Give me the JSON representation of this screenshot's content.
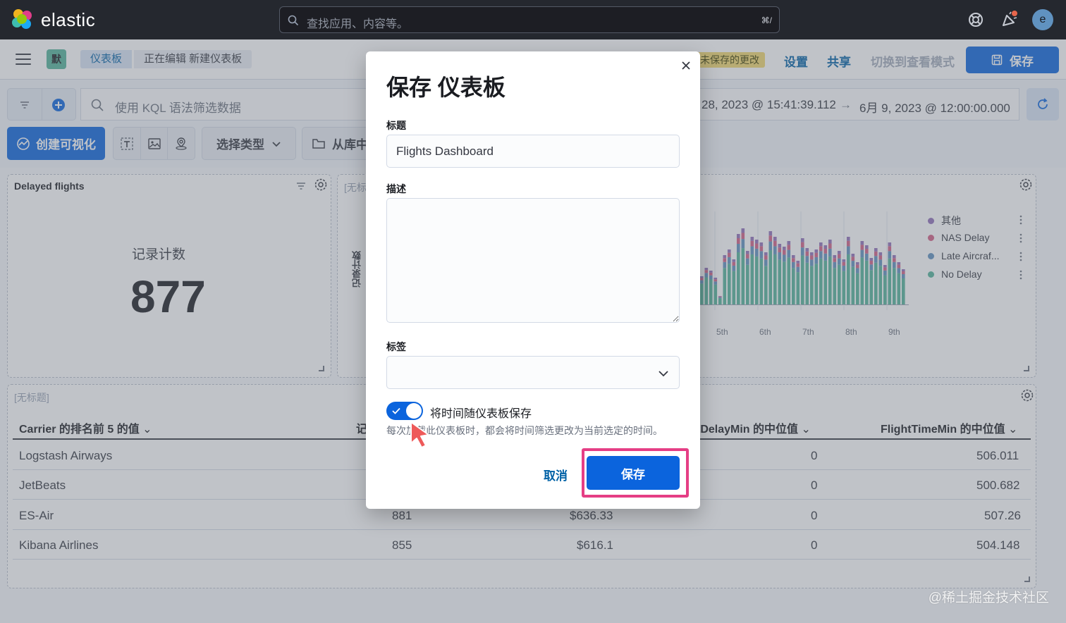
{
  "header": {
    "logo_text": "elastic",
    "search_placeholder": "查找应用、内容等。",
    "search_shortcut": "⌘/",
    "avatar_initial": "e"
  },
  "nav": {
    "space_badge": "默",
    "breadcrumbs": [
      "仪表板",
      "正在编辑 新建仪表板"
    ],
    "unsaved_badge": "未保存的更改",
    "links": [
      "设置",
      "共享",
      "切换到查看模式"
    ],
    "save_label": "保存"
  },
  "query": {
    "kql_placeholder": "使用 KQL 语法筛选数据",
    "time_start": "28, 2023 @ 15:41:39.112",
    "time_end": "6月 9, 2023 @ 12:00:00.000"
  },
  "toolbar": {
    "create_label": "创建可视化",
    "type_label": "选择类型",
    "library_label": "从库中"
  },
  "panels": {
    "metric": {
      "title": "Delayed flights",
      "label": "记录计数",
      "value": "877"
    },
    "chart": {
      "title_fragment": "[无标",
      "y_label": "记录计数",
      "legend": [
        {
          "name": "其他",
          "color": "#9170b8"
        },
        {
          "name": "NAS Delay",
          "color": "#e7664c"
        },
        {
          "name": "Late Aircraf...",
          "color": "#6092c0"
        },
        {
          "name": "No Delay",
          "color": "#54b399"
        }
      ],
      "x_ticks": [
        "5th",
        "6th",
        "7th",
        "8th",
        "9th"
      ]
    },
    "table": {
      "title": "[无标题]",
      "headers": [
        "Carrier 的排名前 5 的值",
        "记",
        "tDelayMin 的中位值",
        "FlightTimeMin 的中位值"
      ],
      "rows": [
        {
          "carrier": "Logstash Airways",
          "count": "",
          "price": "",
          "delay": "0",
          "time": "506.011"
        },
        {
          "carrier": "JetBeats",
          "count": "",
          "price": "",
          "delay": "0",
          "time": "500.682"
        },
        {
          "carrier": "ES-Air",
          "count": "881",
          "price": "$636.33",
          "delay": "0",
          "time": "507.26"
        },
        {
          "carrier": "Kibana Airlines",
          "count": "855",
          "price": "$616.1",
          "delay": "0",
          "time": "504.148"
        }
      ]
    }
  },
  "modal": {
    "title": "保存 仪表板",
    "title_label": "标题",
    "title_value": "Flights Dashboard",
    "description_label": "描述",
    "tags_label": "标签",
    "store_time_label": "将时间随仪表板保存",
    "store_time_help": "每次加载此仪表板时，都会将时间筛选更改为当前选定的时间。",
    "store_time_on": true,
    "cancel_label": "取消",
    "save_label": "保存"
  },
  "watermark": "@稀土掘金技术社区",
  "colors": {
    "primary": "#0b64dd",
    "highlight": "#e53e85",
    "header_bg": "#25282f"
  }
}
